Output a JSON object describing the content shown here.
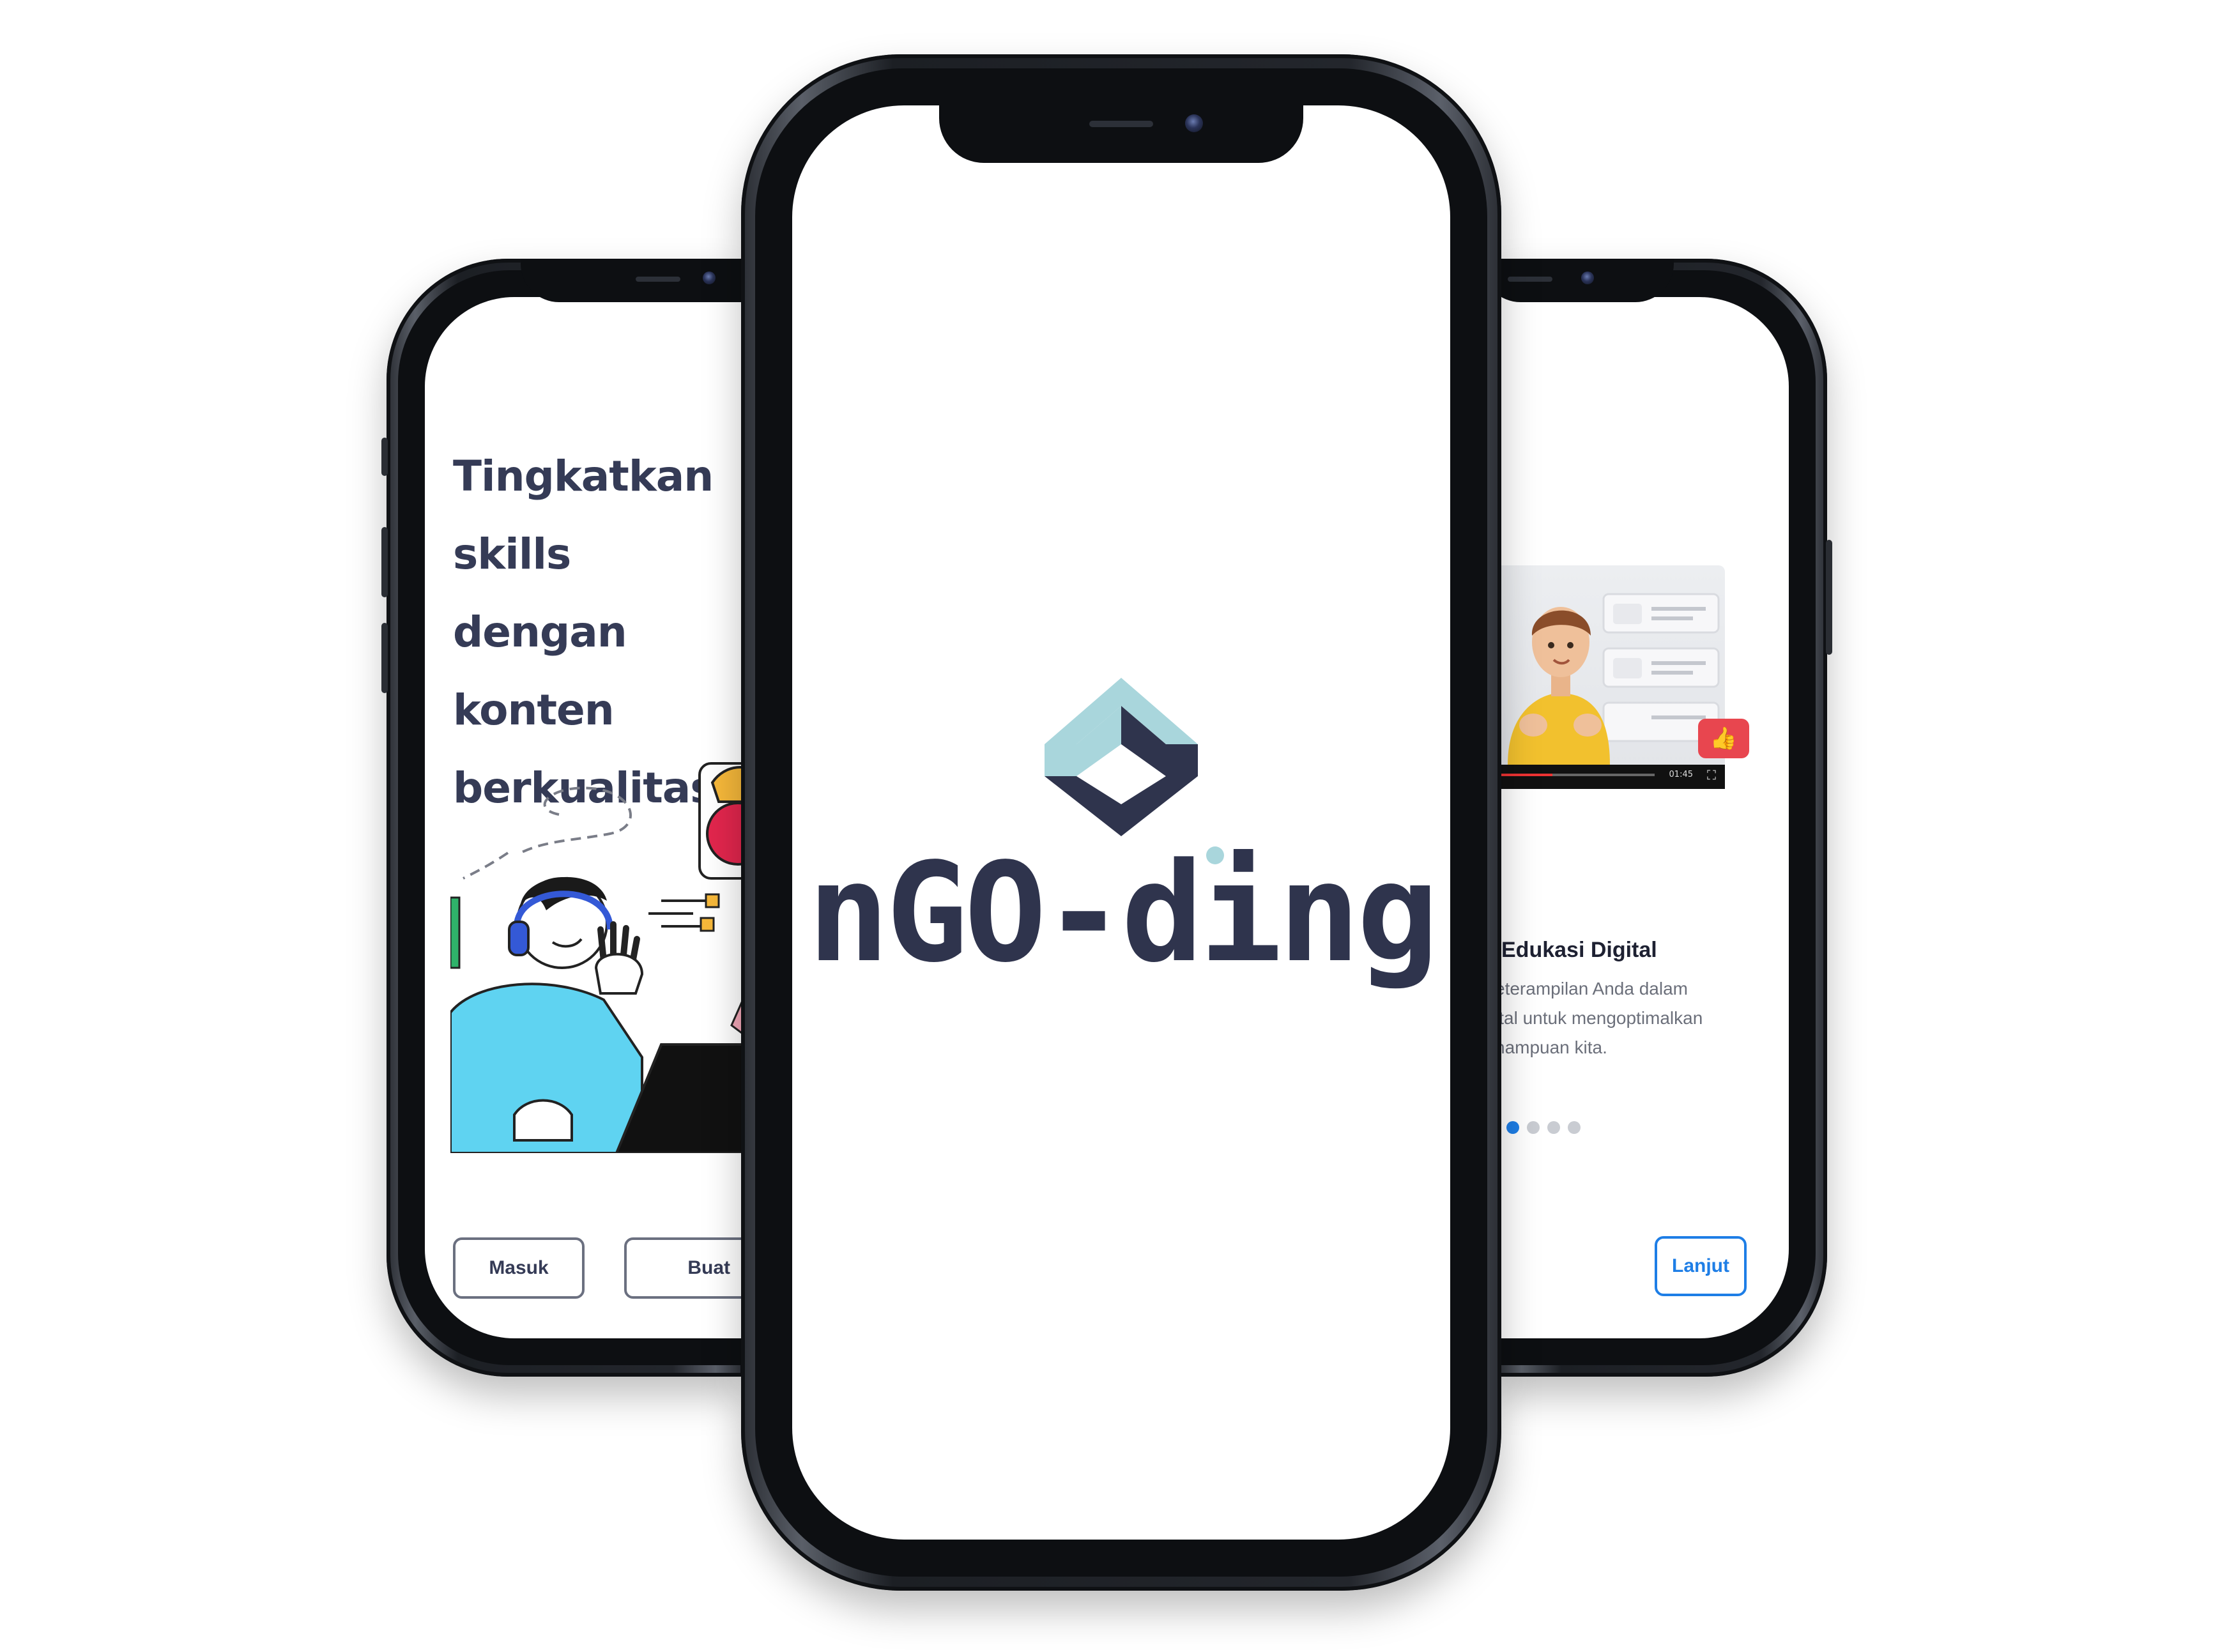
{
  "left_screen": {
    "headline_lines": [
      "Tingkatkan",
      "skills dengan",
      "konten",
      "berkualitas."
    ],
    "buttons": {
      "masuk": "Masuk",
      "buat": "Buat"
    }
  },
  "center_screen": {
    "brand": "nGO-ding",
    "colors": {
      "brand_text": "#2f344d",
      "logo_light": "#a9d6dc",
      "logo_dark": "#2f344d"
    }
  },
  "right_screen": {
    "video_time": "01:45",
    "title": "Edukasi Digital",
    "description_lines": [
      "eterampilan Anda dalam",
      "ital  untuk mengoptimalkan",
      "nampuan kita."
    ],
    "pagination": {
      "total": 4,
      "active": 1
    },
    "next_button": "Lanjut",
    "colors": {
      "accent": "#1e7ee6"
    }
  }
}
